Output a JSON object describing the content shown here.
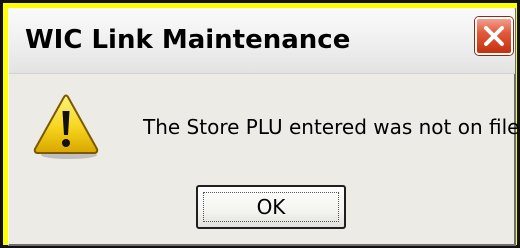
{
  "window": {
    "title": "WIC Link Maintenance"
  },
  "message": {
    "text": "The Store PLU entered was not on file.",
    "icon": "warning-icon"
  },
  "buttons": {
    "ok_label": "OK",
    "close_icon": "close-icon"
  },
  "colors": {
    "highlight_background": "#ffff00",
    "dialog_background": "#edebe6",
    "close_button": "#d9492b",
    "warning_yellow": "#f7d51e"
  }
}
